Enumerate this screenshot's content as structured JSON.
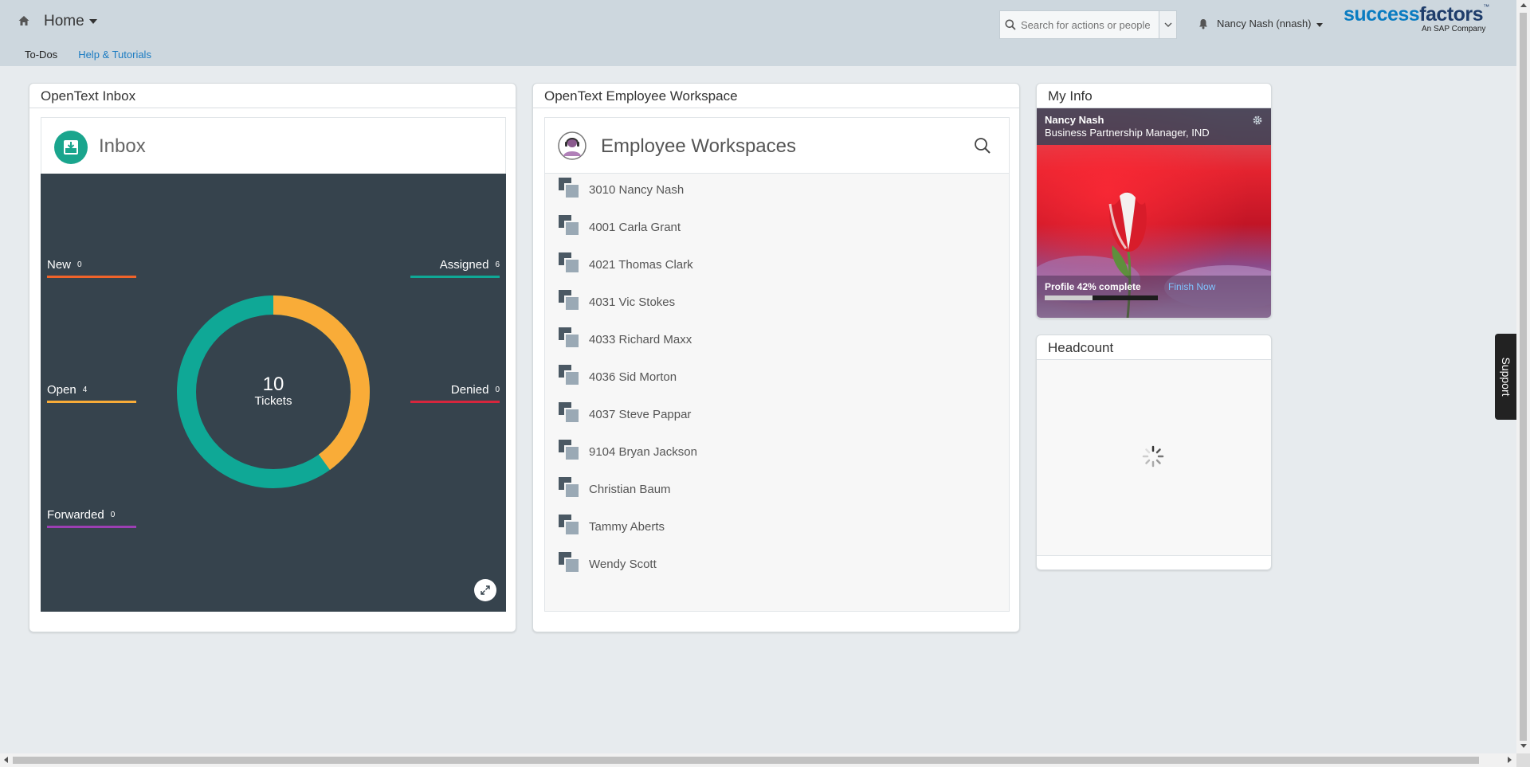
{
  "header": {
    "home_label": "Home",
    "subnav": {
      "todos": "To-Dos",
      "help": "Help & Tutorials"
    },
    "search": {
      "placeholder": "Search for actions or people"
    },
    "user_label": "Nancy Nash (nnash)",
    "logo": {
      "word1": "success",
      "word2": "factors",
      "tm": "™",
      "tagline": "An SAP Company"
    }
  },
  "inbox_card": {
    "title": "OpenText Inbox",
    "widget_title": "Inbox",
    "total": "10",
    "total_label": "Tickets",
    "statuses": {
      "new": {
        "label": "New",
        "count": "0",
        "color": "#f0632a"
      },
      "assigned": {
        "label": "Assigned",
        "count": "6",
        "color": "#0fa896"
      },
      "open": {
        "label": "Open",
        "count": "4",
        "color": "#f9ac38"
      },
      "denied": {
        "label": "Denied",
        "count": "0",
        "color": "#d7263d"
      },
      "forwarded": {
        "label": "Forwarded",
        "count": "0",
        "color": "#9c3fb3"
      }
    }
  },
  "workspace_card": {
    "title": "OpenText Employee Workspace",
    "widget_title": "Employee Workspaces",
    "items": [
      "3010 Nancy Nash",
      "4001 Carla Grant",
      "4021 Thomas Clark",
      "4031 Vic Stokes",
      "4033 Richard Maxx",
      "4036 Sid Morton",
      "4037 Steve Pappar",
      "9104 Bryan Jackson",
      "Christian Baum",
      "Tammy Aberts",
      "Wendy Scott"
    ]
  },
  "myinfo_card": {
    "title": "My Info",
    "name": "Nancy Nash",
    "job_title": "Business Partnership Manager, IND",
    "profile_text": "Profile 42% complete",
    "profile_percent": 42,
    "finish_label": "Finish Now"
  },
  "headcount_card": {
    "title": "Headcount"
  },
  "support_label": "Support",
  "colors": {
    "header_bg": "#cdd7de",
    "accent_blue": "#1a7bc2",
    "inbox_dark": "#36434d",
    "teal": "#0fa896",
    "orange": "#f9ac38"
  }
}
